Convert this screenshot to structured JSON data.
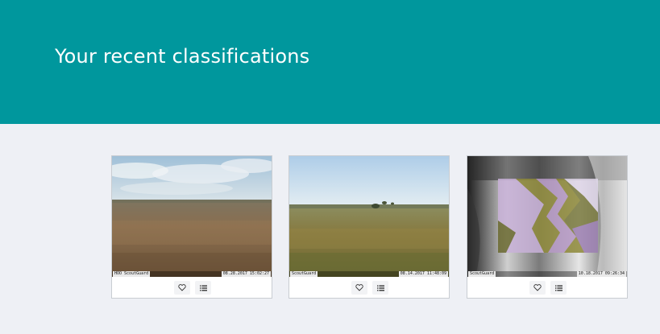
{
  "header": {
    "title": "Your recent classifications",
    "background": "#00979d"
  },
  "classifications": [
    {
      "stamp_left": "HOO ScoutGuard",
      "stamp_right": "08.28.2017 15:02:27",
      "scene": "savanna-cloudy"
    },
    {
      "stamp_left": "ScoutGuard",
      "stamp_right": "08.14.2017 11:48:09",
      "scene": "savanna-green"
    },
    {
      "stamp_left": "ScoutGuard",
      "stamp_right": "10.18.2017 09:26:34",
      "scene": "closeup-animal"
    }
  ],
  "icons": {
    "favorite": "heart-icon",
    "collect": "list-icon"
  }
}
